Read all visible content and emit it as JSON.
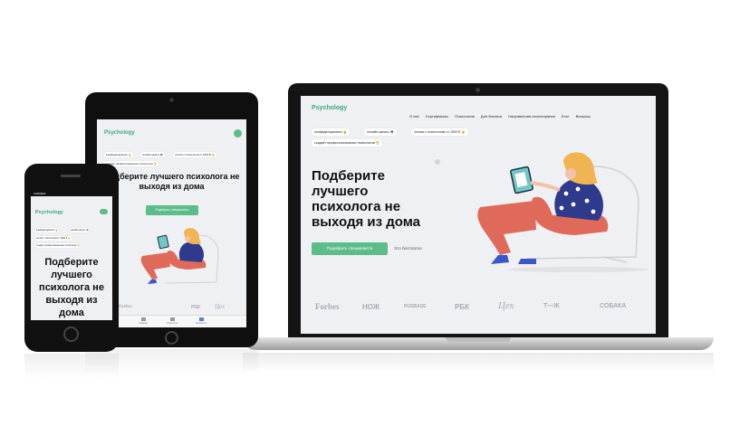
{
  "laptop": {
    "logo": "Psychology",
    "nav": [
      "О нас",
      "Сертификаты",
      "Психологии",
      "Для бизнеса",
      "Направления психотерапии",
      "Блог",
      "Вопросы"
    ],
    "chips": [
      "конфиденциально 🔒",
      "онлайн-запись 💻",
      "сессия с психологом от 1500 ₽ 👍",
      "создаёт профессиональных психологов 🏆"
    ],
    "heading": [
      "Подберите",
      "лучшего",
      "психолога не",
      "выходя из дома"
    ],
    "cta": "Подобрать специалиста",
    "free": "Это бесплатно",
    "brands": [
      "Forbes",
      "НОЖ",
      "RUSBASE",
      "РБК",
      "Цех",
      "Т—Ж",
      "СОБАКА"
    ]
  },
  "tablet": {
    "logo": "Psychology",
    "chips": [
      "конфиденциально 🔒",
      "онлайн-запись 💻",
      "сессия с психологом от 1500 ₽ 👍",
      "создаёт профессиональных психологов 🏆"
    ],
    "heading": [
      "Подберите лучшего психолога не",
      "выходя из дома"
    ],
    "cta": "Подобрать специалиста",
    "brands": [
      "Forbes",
      "РБК",
      "Цех"
    ],
    "tabbar": [
      "Главная",
      "Психологи",
      "Связаться"
    ]
  },
  "phone": {
    "carrier": "CARRIER",
    "logo": "Psychology",
    "chips": [
      "конфиденциально 🔒",
      "онлайн-запись 💻",
      "сессия с психологом от 1500 ₽ 👍",
      "создаёт профессиональных психологов 🏆"
    ],
    "heading": [
      "Подберите",
      "лучшего",
      "психолога не",
      "выходя из",
      "дома"
    ]
  },
  "colors": {
    "accent": "#5cbd88",
    "brand": "#3ea77a",
    "device": "#141414"
  }
}
